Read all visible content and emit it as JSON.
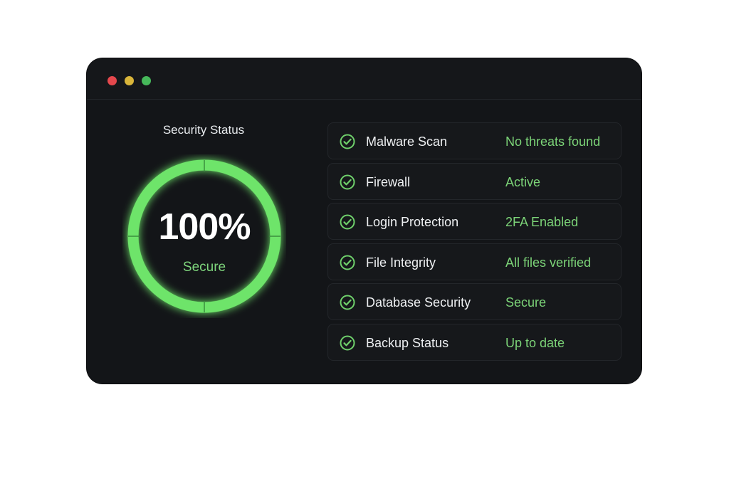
{
  "window": {
    "controls": [
      {
        "name": "close",
        "color": "#e5484d"
      },
      {
        "name": "minimize",
        "color": "#d9b53a"
      },
      {
        "name": "maximize",
        "color": "#46b85a"
      }
    ]
  },
  "gauge": {
    "title": "Security Status",
    "value": "100%",
    "label": "Secure",
    "percent": 100,
    "color": "#6ee46a"
  },
  "checks": [
    {
      "name": "Malware Scan",
      "status": "No threats found",
      "icon": "check-circle-icon"
    },
    {
      "name": "Firewall",
      "status": "Active",
      "icon": "check-circle-icon"
    },
    {
      "name": "Login Protection",
      "status": "2FA Enabled",
      "icon": "check-circle-icon"
    },
    {
      "name": "File Integrity",
      "status": "All files verified",
      "icon": "check-circle-icon"
    },
    {
      "name": "Database Security",
      "status": "Secure",
      "icon": "check-circle-icon"
    },
    {
      "name": "Backup Status",
      "status": "Up to date",
      "icon": "check-circle-icon"
    }
  ],
  "colors": {
    "accent": "#7cd478",
    "background": "#131518"
  }
}
